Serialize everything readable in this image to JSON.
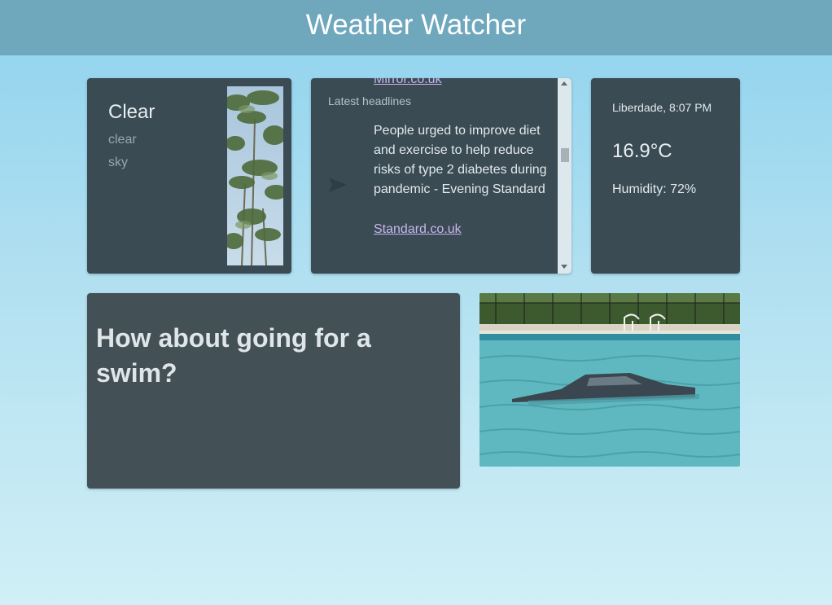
{
  "app": {
    "title": "Weather Watcher"
  },
  "condition": {
    "main": "Clear",
    "description": "clear sky",
    "photo_icon": "palm-trees-photo"
  },
  "news": {
    "previous_source": "Mirror.co.uk",
    "heading": "Latest headlines",
    "headline": "People urged to improve diet and exercise to help reduce risks of type 2 diabetes during pandemic - Evening Standard",
    "source": "Standard.co.uk",
    "arrow_icon": "arrow-right-icon"
  },
  "location": {
    "place_time": "Liberdade, 8:07 PM",
    "temperature": "16.9°C",
    "humidity": "Humidity: 72%"
  },
  "suggestion": {
    "text": "How about going for a swim?",
    "photo_icon": "swimming-pool-photo"
  },
  "colors": {
    "header": "#6fa7bd",
    "card": "#3a4b54",
    "link": "#c9b5ec",
    "bg_top": "#8fd3ee",
    "bg_bottom": "#d0eff6"
  }
}
